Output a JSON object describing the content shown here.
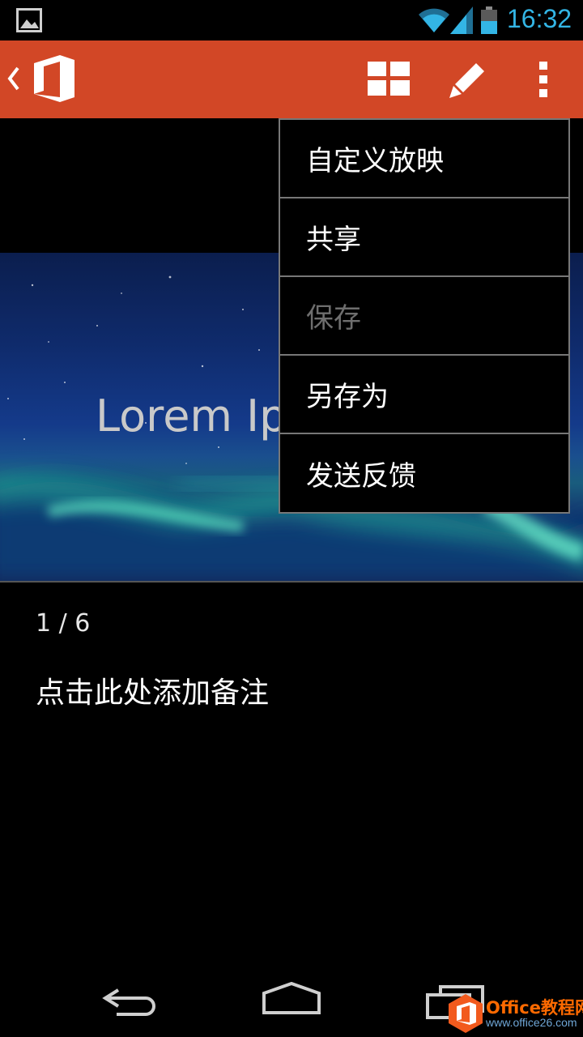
{
  "status_bar": {
    "time": "16:32",
    "icons": [
      "image-notification-icon",
      "wifi-icon",
      "signal-icon",
      "battery-icon"
    ],
    "clock_color": "#33b5e5"
  },
  "action_bar": {
    "color": "#d24726",
    "icons": [
      "back-chevron-icon",
      "office-logo-icon",
      "slide-grid-icon",
      "edit-pencil-icon",
      "overflow-menu-icon"
    ]
  },
  "slide": {
    "title": "Lorem Ip"
  },
  "notes": {
    "counter": "1 / 6",
    "placeholder": "点击此处添加备注"
  },
  "menu": {
    "items": [
      {
        "label": "自定义放映",
        "enabled": true
      },
      {
        "label": "共享",
        "enabled": true
      },
      {
        "label": "保存",
        "enabled": false
      },
      {
        "label": "另存为",
        "enabled": true
      },
      {
        "label": "发送反馈",
        "enabled": true
      }
    ]
  },
  "nav_bar": {
    "icons": [
      "back-icon",
      "home-icon",
      "recents-icon"
    ]
  },
  "watermark": {
    "title": "Office教程网",
    "url": "www.office26.com"
  }
}
